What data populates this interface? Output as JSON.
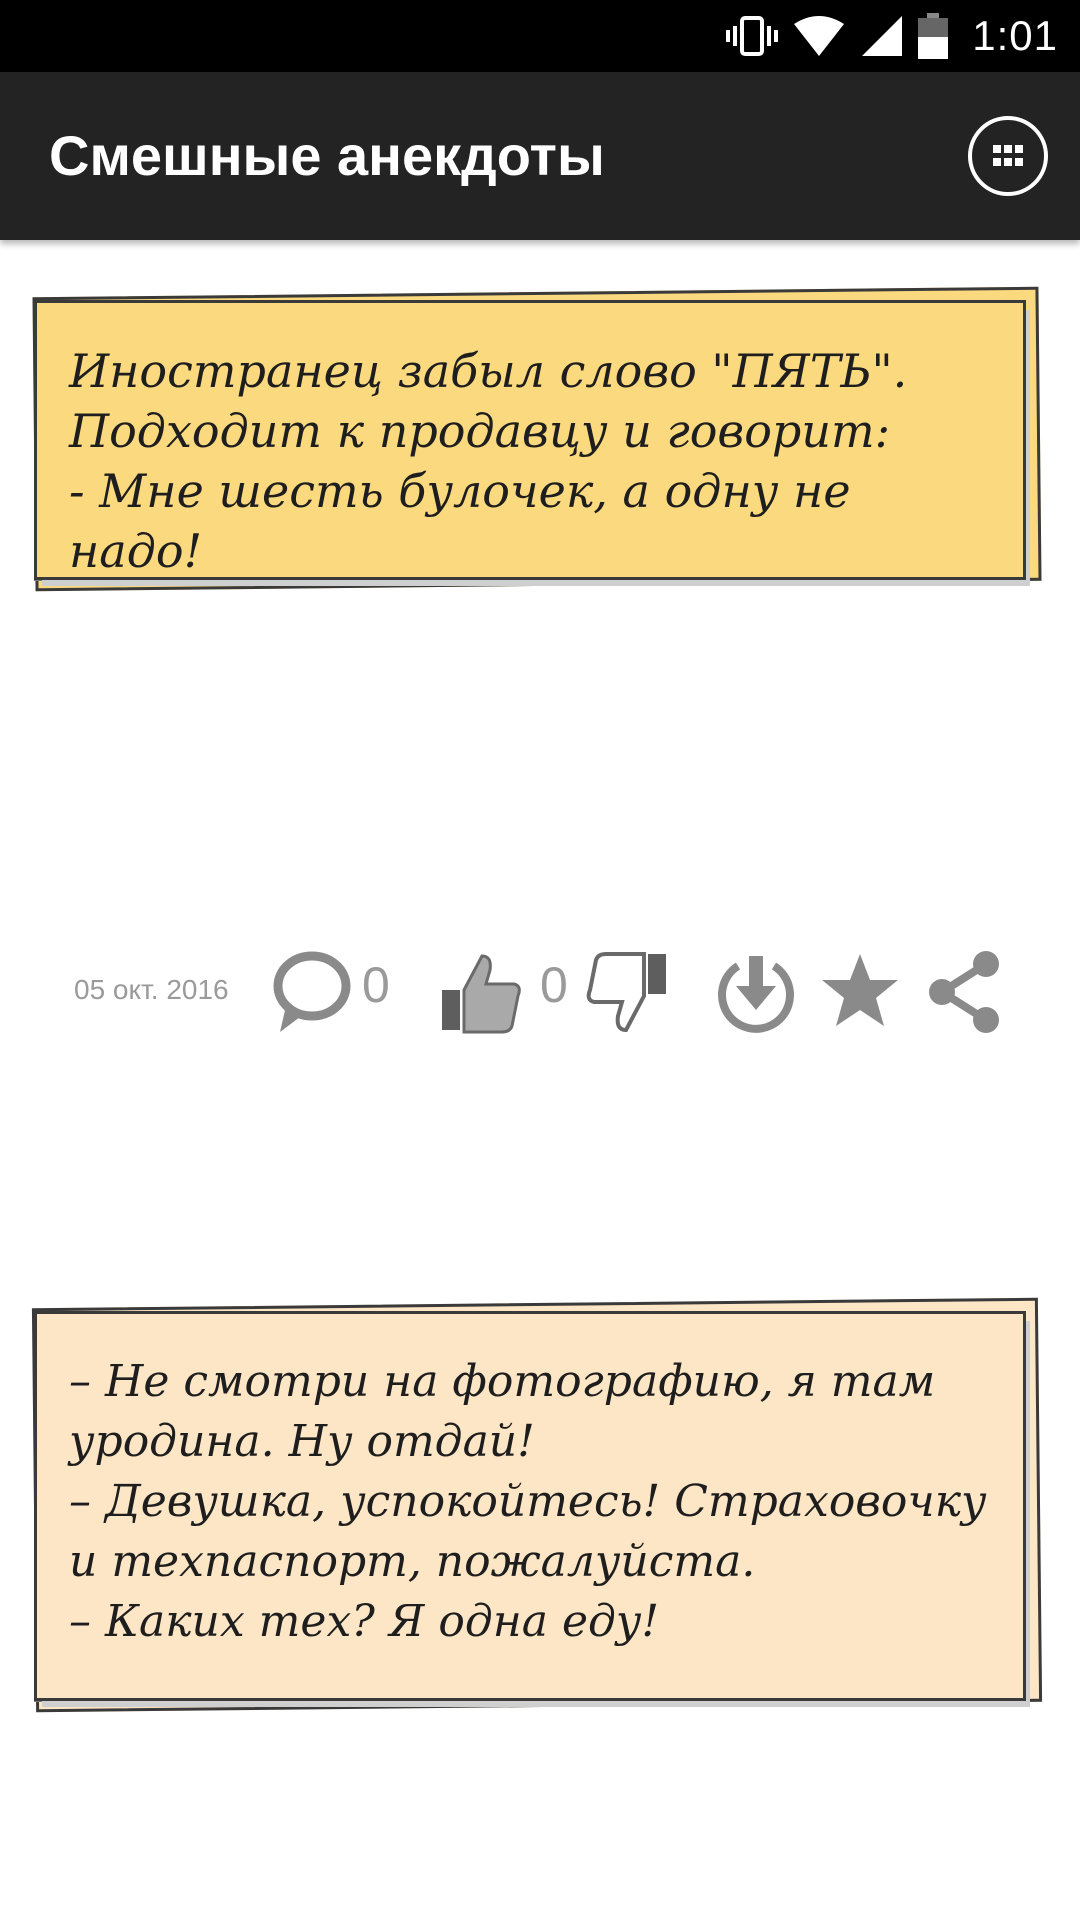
{
  "status_bar": {
    "time": "1:01",
    "icons": [
      "vibrate-icon",
      "wifi-icon",
      "signal-icon",
      "battery-icon"
    ]
  },
  "app_bar": {
    "title": "Смешные анекдоты",
    "menu_icon": "apps-grid-icon"
  },
  "jokes": [
    {
      "text": "Иностранец забыл слово \"ПЯТЬ\".\nПодходит к продавцу и говорит:\n- Мне шесть булочек, а одну не надо!",
      "card_color": "#fad97f"
    },
    {
      "text": "– Не смотри на фотографию, я там\nуродина. Ну отдай!\n– Девушка, успокойтесь! Страховочку\nи техпаспорт, пожалуйста.\n– Каких тех? Я одна еду!",
      "card_color": "#fde6c6"
    }
  ],
  "actions": {
    "date": "05 окт. 2016",
    "comments_count": "0",
    "likes_count": "0",
    "icons": [
      "comment-icon",
      "thumbs-up-icon",
      "thumbs-down-icon",
      "download-icon",
      "star-icon",
      "share-icon"
    ]
  },
  "colors": {
    "status_bar": "#000000",
    "app_bar": "#232323",
    "icon_gray": "#8a8a8a",
    "muted_text": "#9a9a9a"
  }
}
